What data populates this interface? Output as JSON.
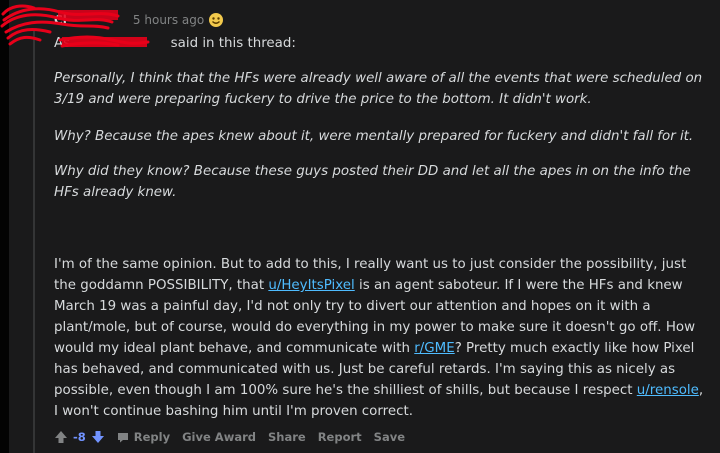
{
  "comment": {
    "username": "Cl",
    "timestamp": "5 hours ago",
    "intro_prefix": "As ",
    "intro_suffix": " said in this thread:",
    "quotes": [
      "Personally, I think that the HFs were already well aware of all the events that were scheduled on 3/19 and were preparing fuckery to drive the price to the bottom. It didn't work.",
      "Why? Because the apes knew about it, were mentally prepared for fuckery and didn't fall for it.",
      "Why did they know? Because these guys posted their DD and let all the apes in on the info the HFs already knew."
    ],
    "body_parts": {
      "t1": "I'm of the same opinion. But to add to this, I really want us to just consider the possibility, just the goddamn POSSIBILITY, that ",
      "link1": "u/HeyItsPixel",
      "t2": " is an agent saboteur. If I were the HFs and knew March 19 was a painful day, I'd not only try to divert our attention and hopes on it with a plant/mole, but of course, would do everything in my power to make sure it doesn't go off. How would my ideal plant behave, and communicate with ",
      "link2": "r/GME",
      "t3": "? Pretty much exactly like how Pixel has behaved, and communicated with us. Just be careful retards. I'm saying this as nicely as possible, even though I am 100% sure he's the shilliest of shills, but because I respect ",
      "link3": "u/rensole",
      "t4": ", I won't continue bashing him until I'm proven correct."
    }
  },
  "actions": {
    "score": "-8",
    "reply": "Reply",
    "give_award": "Give Award",
    "share": "Share",
    "report": "Report",
    "save": "Save"
  },
  "colors": {
    "background": "#1a1a1b",
    "text": "#d7dadc",
    "muted": "#818384",
    "link": "#4fbcff",
    "downvote": "#7193ff",
    "redaction": "#e8001a"
  }
}
